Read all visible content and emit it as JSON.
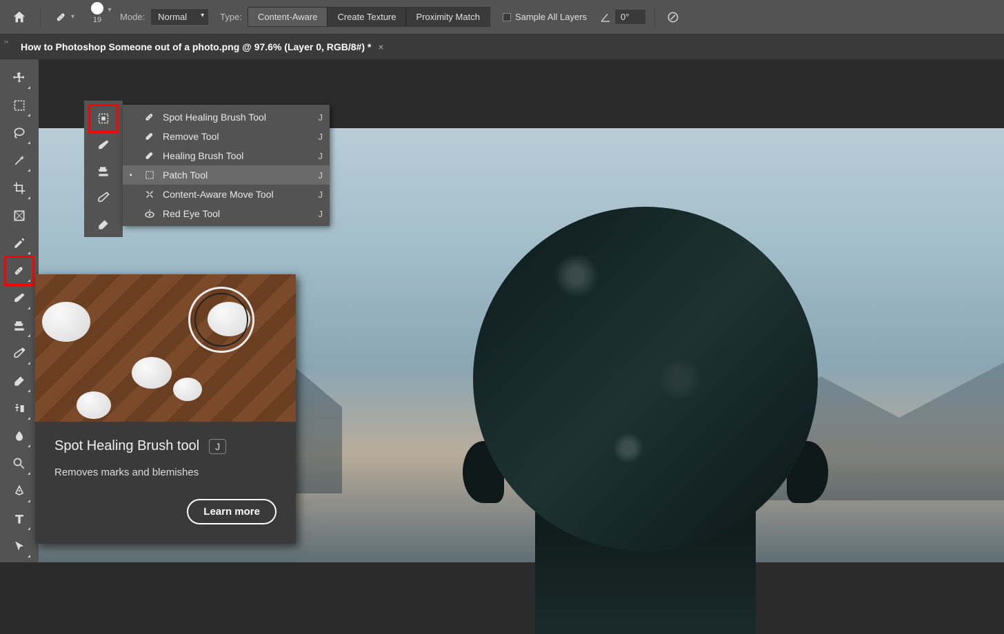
{
  "options_bar": {
    "brush_size": "19",
    "mode_label": "Mode:",
    "mode_value": "Normal",
    "type_label": "Type:",
    "type_buttons": [
      "Content-Aware",
      "Create Texture",
      "Proximity Match"
    ],
    "type_active_index": 0,
    "sample_all_label": "Sample All Layers",
    "angle_value": "0°"
  },
  "document_tab": {
    "title": "How to Photoshop Someone out of a photo.png @ 97.6% (Layer 0, RGB/8#) *"
  },
  "flyout_menu": {
    "items": [
      {
        "label": "Spot Healing Brush Tool",
        "key": "J",
        "icon": "bandage"
      },
      {
        "label": "Remove Tool",
        "key": "J",
        "icon": "bandage"
      },
      {
        "label": "Healing Brush Tool",
        "key": "J",
        "icon": "bandage"
      },
      {
        "label": "Patch Tool",
        "key": "J",
        "icon": "patch",
        "selected": true
      },
      {
        "label": "Content-Aware Move Tool",
        "key": "J",
        "icon": "move-arrows"
      },
      {
        "label": "Red Eye Tool",
        "key": "J",
        "icon": "eye"
      }
    ]
  },
  "tooltip": {
    "title": "Spot Healing Brush tool",
    "key": "J",
    "description": "Removes marks and blemishes",
    "button": "Learn more"
  }
}
